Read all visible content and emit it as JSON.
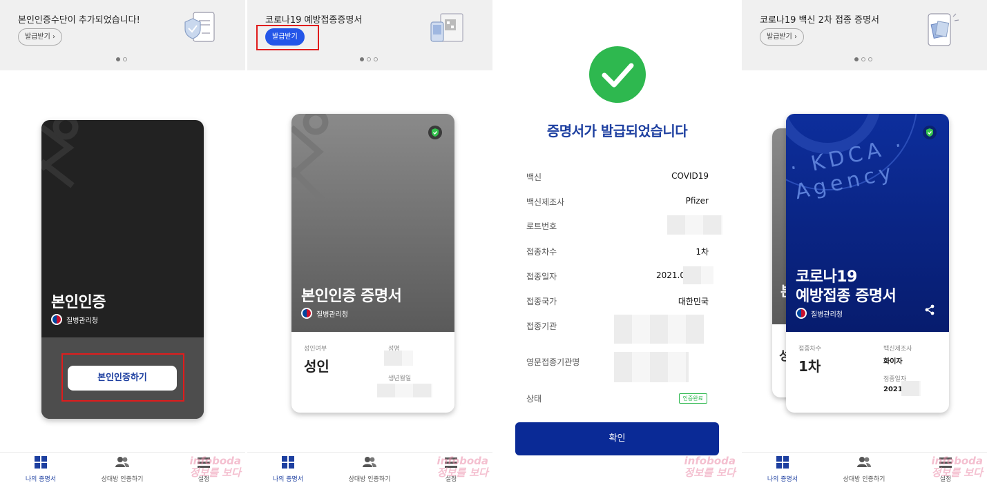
{
  "panels": [
    {
      "banner": {
        "title": "본인인증수단이 추가되었습니다!",
        "button": "발급받기 ›"
      },
      "card": {
        "title": "본인인증",
        "issuer": "질병관리청",
        "action_button": "본인인증하기"
      }
    },
    {
      "banner": {
        "title": "코로나19 예방접종증명서",
        "button": "발급받기"
      },
      "card": {
        "title": "본인인증 증명서",
        "issuer": "질병관리청",
        "adult_label": "성인여부",
        "adult_value": "성인",
        "name_label": "성명",
        "birth_label": "생년월일"
      }
    },
    {
      "success_title": "증명서가 발급되었습니다",
      "rows": [
        {
          "label": "백신",
          "value": "COVID19"
        },
        {
          "label": "백신제조사",
          "value": "Pfizer"
        },
        {
          "label": "로트번호",
          "value": ""
        },
        {
          "label": "접종차수",
          "value": "1차"
        },
        {
          "label": "접종일자",
          "value": "2021.0"
        },
        {
          "label": "접종국가",
          "value": "대한민국"
        },
        {
          "label": "접종기관",
          "value": ""
        },
        {
          "label": "영문접종기관명",
          "value": ""
        },
        {
          "label": "상태",
          "value": "인증완료"
        }
      ],
      "confirm_button": "확인"
    },
    {
      "banner": {
        "title": "코로나19 백신 2차 접종 증명서",
        "button": "발급받기 ›"
      },
      "card": {
        "agency_text": "· KDCA · Agency",
        "title_line1": "코로나19",
        "title_line2": "예방접종 증명서",
        "issuer": "질병관리청",
        "dose_label": "접종차수",
        "dose_value": "1차",
        "maker_label": "백신제조사",
        "maker_value": "화이자",
        "date_label": "접종일자",
        "date_value": "2021."
      },
      "back_card": {
        "peek_char": "본",
        "peek_char2": "성"
      }
    }
  ],
  "nav": {
    "my_cert": "나의 증명서",
    "verify_other": "상대방 인증하기",
    "settings": "설정"
  },
  "watermark": {
    "line1": "infoboda",
    "line2": "정보를 보다"
  },
  "colors": {
    "primary": "#2456e8",
    "navy": "#0a2a96",
    "success": "#2eb84f",
    "highlight": "#e01c1c"
  }
}
